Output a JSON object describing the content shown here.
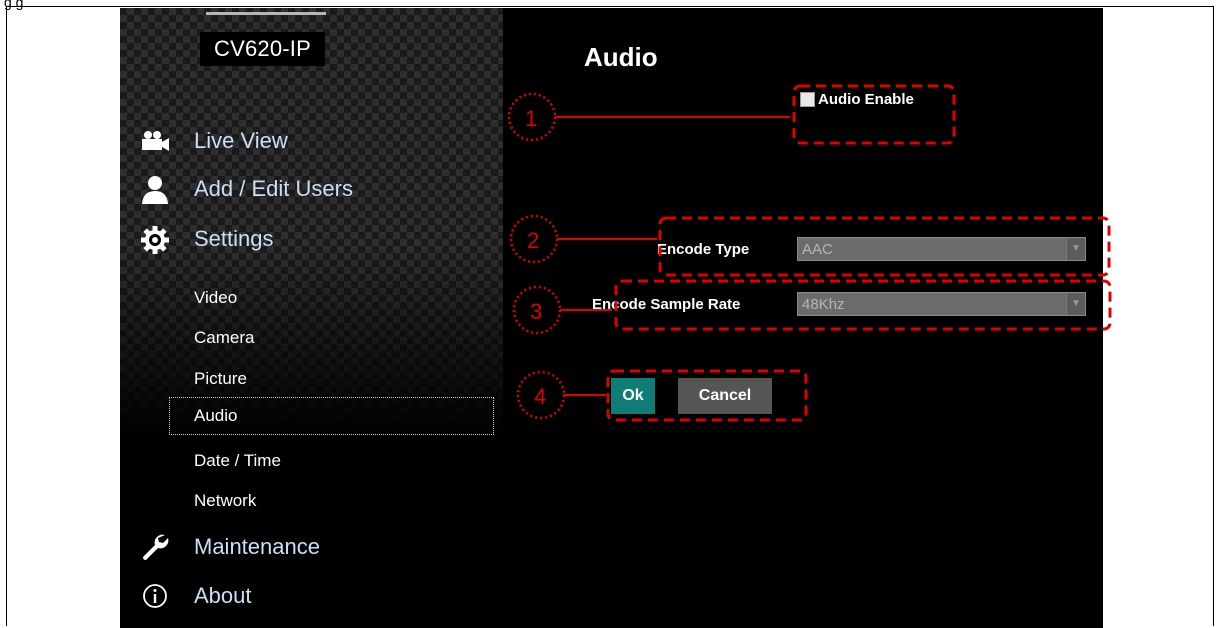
{
  "header": {
    "model_name": "CV620-IP",
    "top_caption": "g        g"
  },
  "sidebar": {
    "items": [
      {
        "label": "Live View",
        "icon": "video-camera-icon"
      },
      {
        "label": "Add / Edit Users",
        "icon": "user-icon"
      },
      {
        "label": "Settings",
        "icon": "gear-icon"
      }
    ],
    "sub_items": [
      {
        "label": "Video"
      },
      {
        "label": "Camera"
      },
      {
        "label": "Picture"
      },
      {
        "label": "Audio",
        "active": true
      },
      {
        "label": "Date / Time"
      },
      {
        "label": "Network"
      }
    ],
    "bottom_items": [
      {
        "label": "Maintenance",
        "icon": "wrench-icon"
      },
      {
        "label": "About",
        "icon": "info-icon"
      }
    ]
  },
  "main": {
    "title": "Audio",
    "audio_enable_label": "Audio Enable",
    "audio_enable_checked": false,
    "encode_type_label": "Encode Type",
    "encode_type_value": "AAC",
    "sample_rate_label": "Encode Sample Rate",
    "sample_rate_value": "48Khz",
    "ok_label": "Ok",
    "cancel_label": "Cancel"
  },
  "callouts": [
    "1",
    "2",
    "3",
    "4"
  ],
  "colors": {
    "accent_ok": "#0f7c76",
    "callout": "#e00000",
    "nav_text": "#cbdff6"
  }
}
